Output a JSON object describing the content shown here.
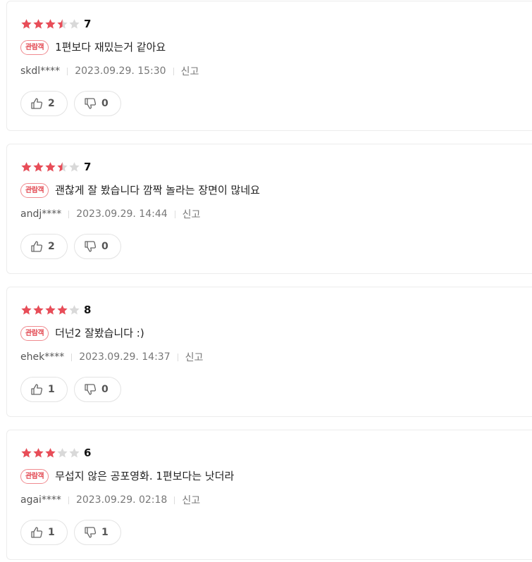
{
  "colors": {
    "star_filled": "#e84d58",
    "star_empty": "#d9d9d9",
    "badge": "#e2464f"
  },
  "reviews": [
    {
      "rating": 7,
      "score": "7",
      "badge": "관람객",
      "text": "1편보다 재밌는거 같아요",
      "user": "skdl****",
      "datetime": "2023.09.29. 15:30",
      "report": "신고",
      "likes": "2",
      "dislikes": "0"
    },
    {
      "rating": 7,
      "score": "7",
      "badge": "관람객",
      "text": "괜찮게 잘 봤습니다 깜짝 놀라는 장면이 많네요",
      "user": "andj****",
      "datetime": "2023.09.29. 14:44",
      "report": "신고",
      "likes": "2",
      "dislikes": "0"
    },
    {
      "rating": 8,
      "score": "8",
      "badge": "관람객",
      "text": "더넌2 잘봤습니다 :)",
      "user": "ehek****",
      "datetime": "2023.09.29. 14:37",
      "report": "신고",
      "likes": "1",
      "dislikes": "0"
    },
    {
      "rating": 6,
      "score": "6",
      "badge": "관람객",
      "text": "무섭지 않은 공포영화. 1편보다는 낫더라",
      "user": "agai****",
      "datetime": "2023.09.29. 02:18",
      "report": "신고",
      "likes": "1",
      "dislikes": "1"
    }
  ],
  "icons": {
    "star": "star-icon",
    "like": "thumbs-up-icon",
    "dislike": "thumbs-down-icon"
  }
}
